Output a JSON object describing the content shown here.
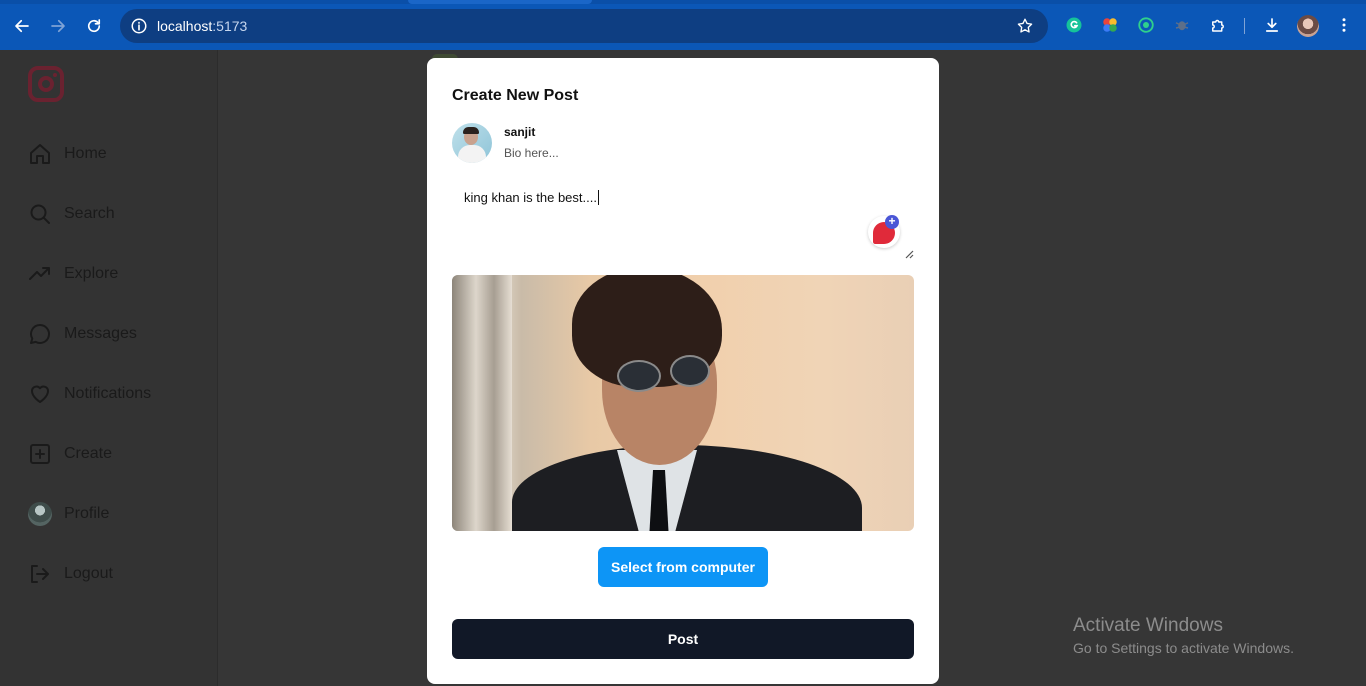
{
  "browser": {
    "url_host": "localhost",
    "url_port": ":5173"
  },
  "sidebar": {
    "items": [
      {
        "label": "Home",
        "icon": "home-icon"
      },
      {
        "label": "Search",
        "icon": "search-icon"
      },
      {
        "label": "Explore",
        "icon": "trending-up-icon"
      },
      {
        "label": "Messages",
        "icon": "message-bubble-icon"
      },
      {
        "label": "Notifications",
        "icon": "heart-icon"
      },
      {
        "label": "Create",
        "icon": "plus-square-icon"
      },
      {
        "label": "Profile",
        "icon": "avatar"
      },
      {
        "label": "Logout",
        "icon": "logout-icon"
      }
    ]
  },
  "modal": {
    "title": "Create New Post",
    "username": "sanjit",
    "bio": "Bio here...",
    "caption": "king khan is the best....",
    "select_button": "Select from computer",
    "post_button": "Post"
  },
  "watermark": {
    "title": "Activate Windows",
    "subtitle": "Go to Settings to activate Windows."
  },
  "colors": {
    "chrome": "#0b57b7",
    "primary_button": "#0d95f6",
    "post_button": "#111827",
    "overlay": "#363636"
  }
}
